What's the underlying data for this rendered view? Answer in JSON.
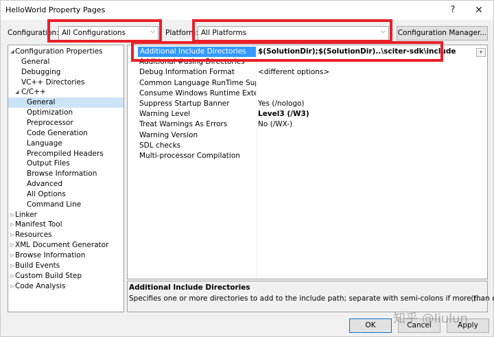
{
  "window": {
    "title": "HelloWorld Property Pages",
    "help_glyph": "?",
    "close_glyph": "✕"
  },
  "toolbar": {
    "configuration_label": "Configuration:",
    "configuration_value": "All Configurations",
    "platform_label": "Platform:",
    "platform_value": "All Platforms",
    "config_manager_label": "Configuration Manager..."
  },
  "tree": {
    "items": [
      {
        "label": "Configuration Properties",
        "expander": "◢"
      },
      {
        "label": "General"
      },
      {
        "label": "Debugging"
      },
      {
        "label": "VC++ Directories"
      },
      {
        "label": "C/C++",
        "expander": "◢"
      },
      {
        "label": "General",
        "selected": true
      },
      {
        "label": "Optimization"
      },
      {
        "label": "Preprocessor"
      },
      {
        "label": "Code Generation"
      },
      {
        "label": "Language"
      },
      {
        "label": "Precompiled Headers"
      },
      {
        "label": "Output Files"
      },
      {
        "label": "Browse Information"
      },
      {
        "label": "Advanced"
      },
      {
        "label": "All Options"
      },
      {
        "label": "Command Line"
      },
      {
        "label": "Linker",
        "expander": "▷"
      },
      {
        "label": "Manifest Tool",
        "expander": "▷"
      },
      {
        "label": "Resources",
        "expander": "▷"
      },
      {
        "label": "XML Document Generator",
        "expander": "▷"
      },
      {
        "label": "Browse Information",
        "expander": "▷"
      },
      {
        "label": "Build Events",
        "expander": "▷"
      },
      {
        "label": "Custom Build Step",
        "expander": "▷"
      },
      {
        "label": "Code Analysis",
        "expander": "▷"
      }
    ]
  },
  "grid": {
    "rows": [
      {
        "name": "Additional Include Directories",
        "value": "$(SolutionDir);$(SolutionDir)..\\sciter-sdk\\include",
        "bold": true,
        "selected": true
      },
      {
        "name": "Additional #using Directories",
        "value": ""
      },
      {
        "name": "Debug Information Format",
        "value": "<different options>"
      },
      {
        "name": "Common Language RunTime Support",
        "value": ""
      },
      {
        "name": "Consume Windows Runtime Extension",
        "value": ""
      },
      {
        "name": "Suppress Startup Banner",
        "value": "Yes (/nologo)"
      },
      {
        "name": "Warning Level",
        "value": "Level3 (/W3)",
        "bold": true
      },
      {
        "name": "Treat Warnings As Errors",
        "value": "No (/WX-)"
      },
      {
        "name": "Warning Version",
        "value": ""
      },
      {
        "name": "SDL checks",
        "value": ""
      },
      {
        "name": "Multi-processor Compilation",
        "value": ""
      }
    ],
    "dropdown_glyph": "▾"
  },
  "description": {
    "title": "Additional Include Directories",
    "text": "Specifies one or more directories to add to the include path; separate with semi-colons if more than one.",
    "more": "(/..."
  },
  "buttons": {
    "ok": "OK",
    "cancel": "Cancel",
    "apply": "Apply"
  },
  "watermark": "知乎 @liulun",
  "colors": {
    "highlight_box": "#e8202a",
    "selection": "#3399ff",
    "tree_selection": "#cce4f7"
  }
}
